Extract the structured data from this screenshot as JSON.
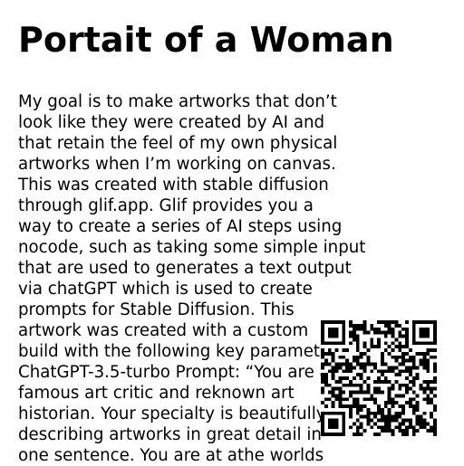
{
  "page": {
    "title": "Portait of a Woman",
    "body_lines": [
      "My goal is to make artworks that don’t",
      "look like they were created by AI and",
      "that retain the feel of my own physical",
      "artworks when I’m working on canvas.",
      "This was created with stable diffusion",
      "through glif.app. Glif provides you a",
      "way to create a series of AI steps using",
      "nocode, such as taking some simple input",
      "that are used to generates a text output",
      "via chatGPT which is used to create",
      "prompts for Stable Diffusion. This",
      "artwork was created with a custom",
      "build with the following key parameters:",
      "ChatGPT-3.5-turbo Prompt: “You are a",
      "famous art critic and reknown art",
      "historian. Your specialty is beautifully",
      "describing artworks in great detail in",
      "one sentence. You are at athe worlds"
    ]
  },
  "qr_code": {
    "icon": "qr-code-icon",
    "color": "#000000"
  }
}
